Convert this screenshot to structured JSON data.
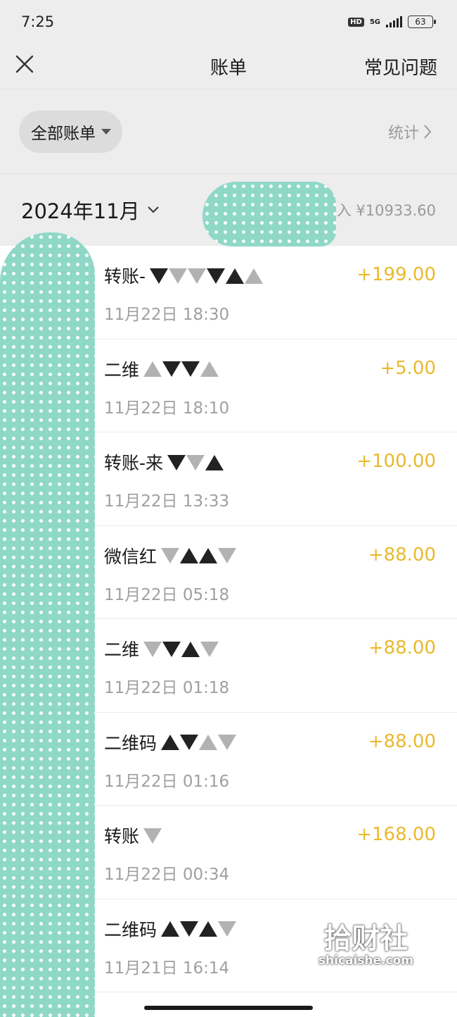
{
  "status_bar": {
    "time": "7:25",
    "hd": "HD",
    "network": "5G",
    "battery": "63"
  },
  "nav": {
    "close_icon": "close-icon",
    "title": "账单",
    "faq_label": "常见问题"
  },
  "filter": {
    "label": "全部账单",
    "stats_label": "统计"
  },
  "month": {
    "label": "2024年11月",
    "income": "收入 ¥10933.60"
  },
  "transactions": [
    {
      "name": "转账-",
      "time": "11月22日 18:30",
      "amount": "+199.00"
    },
    {
      "name": "二维",
      "time": "11月22日 18:10",
      "amount": "+5.00"
    },
    {
      "name": "转账-来",
      "time": "11月22日 13:33",
      "amount": "+100.00"
    },
    {
      "name": "微信红",
      "time": "11月22日 05:18",
      "amount": "+88.00"
    },
    {
      "name": "二维",
      "time": "11月22日 01:18",
      "amount": "+88.00"
    },
    {
      "name": "二维码",
      "time": "11月22日 01:16",
      "amount": "+88.00"
    },
    {
      "name": "转账",
      "time": "11月22日 00:34",
      "amount": "+168.00"
    },
    {
      "name": "二维码",
      "time": "11月21日 16:14",
      "amount": ""
    }
  ],
  "watermark": {
    "cn": "拾财社",
    "en": "shicaishe.com"
  },
  "colors": {
    "amount": "#e9b92e",
    "background": "#ededed",
    "overlay": "#8fd8c8"
  }
}
